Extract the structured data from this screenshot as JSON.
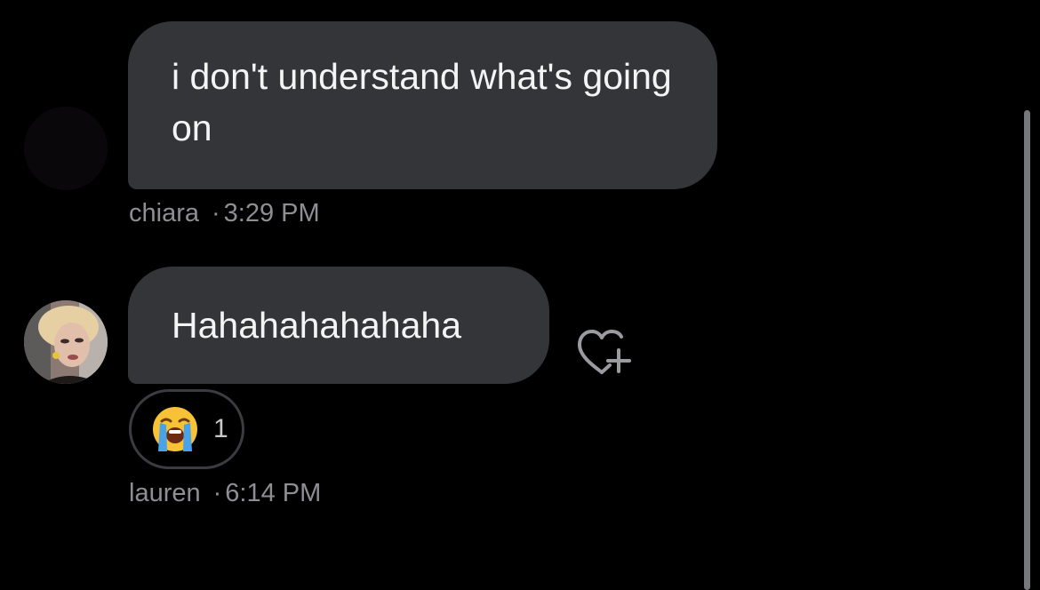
{
  "messages": [
    {
      "text": "i don't understand what's going on",
      "sender": "chiara",
      "separator": "·",
      "time": "3:29 PM"
    },
    {
      "text": "Hahahahahahaha",
      "sender": "lauren",
      "separator": "·",
      "time": "6:14 PM",
      "reaction": {
        "emoji": "loudly-crying-face",
        "count": "1"
      }
    }
  ],
  "icons": {
    "add_reaction": "heart-plus-icon"
  },
  "colors": {
    "background": "#000000",
    "bubble": "#333538",
    "meta_text": "#8e8e93"
  }
}
